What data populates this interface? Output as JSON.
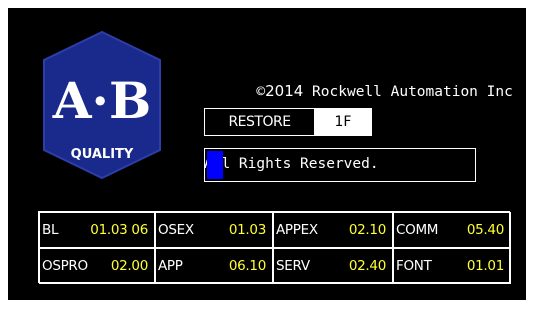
{
  "window": {
    "title": ""
  },
  "colors": {
    "background": "#000000",
    "text": "#ffffff",
    "version_text": "#ffff33",
    "progress_fill": "#0000ff",
    "logo_fill": "#1a2a8c"
  },
  "logo": {
    "mark": "A·B",
    "mark_left": "A",
    "mark_right": "B",
    "subtitle": "QUALITY"
  },
  "copyright": {
    "symbol": "©",
    "year": "2014",
    "company": "Rockwell Automation Inc",
    "rights": "All Rights Reserved."
  },
  "status": {
    "label": "RESTORE",
    "code": "1F"
  },
  "progress": {
    "fraction": 0.06
  },
  "versions": [
    {
      "name": "BL",
      "version": "01.03 06"
    },
    {
      "name": "OSEX",
      "version": "01.03"
    },
    {
      "name": "APPEX",
      "version": "02.10"
    },
    {
      "name": "COMM",
      "version": "05.40"
    },
    {
      "name": "OSPRO",
      "version": "02.00"
    },
    {
      "name": "APP",
      "version": "06.10"
    },
    {
      "name": "SERV",
      "version": "02.40"
    },
    {
      "name": "FONT",
      "version": "01.01"
    }
  ]
}
